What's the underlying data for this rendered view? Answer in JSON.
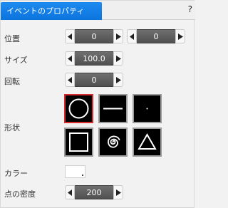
{
  "tab": {
    "label": "イベントのプロパティ"
  },
  "help": {
    "label": "?"
  },
  "rows": {
    "position": {
      "label": "位置",
      "x_value": "0",
      "y_value": "0"
    },
    "size": {
      "label": "サイズ",
      "value": "100.0"
    },
    "rotation": {
      "label": "回転",
      "value": "0"
    },
    "shape": {
      "label": "形状",
      "options": [
        "circle",
        "line",
        "dot",
        "square",
        "spiral",
        "triangle"
      ],
      "selected": "circle"
    },
    "color": {
      "label": "カラー",
      "value": "#ffffff"
    },
    "density": {
      "label": "点の密度",
      "value": "200"
    }
  },
  "icons": {
    "left_arrow": "triangle-left-icon",
    "right_arrow": "triangle-right-icon"
  },
  "colors": {
    "tab_accent": "#0c74de",
    "selected_border": "#d92b2b",
    "stepper_value_bg": "#5a5a5a"
  }
}
